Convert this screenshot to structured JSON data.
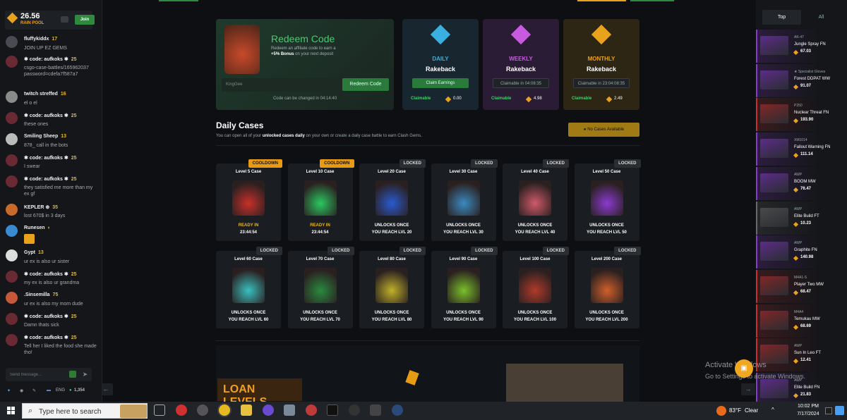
{
  "chat": {
    "rain_amount": "26.56",
    "rain_label": "RAIN POOL",
    "join_label": "Join",
    "messages": [
      {
        "name": "fluffykiddx",
        "level": "17",
        "text": "JOIN UP EZ GEMS",
        "avatar_color": "#4a4a52"
      },
      {
        "name": "✱ code: aufkoks ✱",
        "level": "25",
        "text": "csgo-case-battles/165962037 password=cdefa7f587a7",
        "avatar_color": "#6a2a34"
      },
      {
        "name": "twitch streffed",
        "level": "16",
        "text": "el o el",
        "avatar_color": "#8a8a8a"
      },
      {
        "name": "✱ code: aufkoks ✱",
        "level": "25",
        "text": "these ones",
        "avatar_color": "#6a2a34"
      },
      {
        "name": "Smiling Sheep",
        "level": "13",
        "text": "878_ call in the bots",
        "avatar_color": "#bbbbbb"
      },
      {
        "name": "✱ code: aufkoks ✱",
        "level": "25",
        "text": "I swear",
        "avatar_color": "#6a2a34"
      },
      {
        "name": "✱ code: aufkoks ✱",
        "level": "25",
        "text": "they satisfied me more than my ex gf",
        "avatar_color": "#6a2a34"
      },
      {
        "name": "KEPLER ⊕",
        "level": "35",
        "text": "lost 670$ in 3 days",
        "avatar_color": "#c86a2a"
      },
      {
        "name": "Runesen",
        "level": "◐",
        "text": "",
        "avatar_color": "#3a8ad0"
      },
      {
        "name": "Gypt",
        "level": "13",
        "text": "ur ex is also ur sister",
        "avatar_color": "#dddddd"
      },
      {
        "name": "✱ code: aufkoks ✱",
        "level": "25",
        "text": "my ex is also ur grandma",
        "avatar_color": "#6a2a34"
      },
      {
        "name": ".Sinsemilla",
        "level": "75",
        "text": "ur ex is also my mom dude",
        "avatar_color": "#c8583a"
      },
      {
        "name": "✱ code: aufkoks ✱",
        "level": "25",
        "text": "Damn thats sick",
        "avatar_color": "#6a2a34"
      },
      {
        "name": "✱ code: aufkoks ✱",
        "level": "25",
        "text": "Tell her I liked the food she made tho!",
        "avatar_color": "#6a2a34"
      }
    ],
    "input_placeholder": "Send message...",
    "send_icon": "send-arrow-icon",
    "footer": {
      "lang": "ENG",
      "online": "1,354"
    }
  },
  "redeem": {
    "title": "Redeem Code",
    "desc_line1": "Redeem an affiliate code to earn a",
    "bonus": "+5% Bonus",
    "desc_line2_rest": " on your next deposit",
    "input_value": "KingGee",
    "button": "Redeem Code",
    "note": "Code can be changed in 04:14:40"
  },
  "rakeback": [
    {
      "period": "DAILY",
      "label": "Rakeback",
      "button": "Claim Earnings",
      "claimable_label": "Claimable",
      "value": "0.00",
      "color": "#3ab0e0",
      "bg": "#182630",
      "active": true
    },
    {
      "period": "WEEKLY",
      "label": "Rakeback",
      "button": "Claimable in 04:08:35",
      "claimable_label": "Claimable",
      "value": "4.98",
      "color": "#c85ae0",
      "bg": "#2a1c34",
      "active": false
    },
    {
      "period": "MONTHLY",
      "label": "Rakeback",
      "button": "Claimable in 23:04:08:35",
      "claimable_label": "Claimable",
      "value": "2.49",
      "color": "#e8a21c",
      "bg": "#2e2614",
      "active": false
    }
  ],
  "daily": {
    "title": "Daily Cases",
    "sub_pre": "You can open all of your ",
    "sub_bold": "unlocked cases daily",
    "sub_post": " on your own or create a daily case battle to earn Clash Gems.",
    "no_cases": "No Cases Available"
  },
  "cases": [
    {
      "name": "Level 5 Case",
      "tag": "COOLDOWN",
      "status1": "READY IN",
      "status2": "23:44:54",
      "color": "#c8302a"
    },
    {
      "name": "Level 10 Case",
      "tag": "COOLDOWN",
      "status1": "READY IN",
      "status2": "23:44:54",
      "color": "#2ac860"
    },
    {
      "name": "Level 20 Case",
      "tag": "LOCKED",
      "status1": "UNLOCKS ONCE",
      "status2": "YOU REACH LVL 20",
      "color": "#2a5ad0"
    },
    {
      "name": "Level 30 Case",
      "tag": "LOCKED",
      "status1": "UNLOCKS ONCE",
      "status2": "YOU REACH LVL 30",
      "color": "#3a8ac0"
    },
    {
      "name": "Level 40 Case",
      "tag": "LOCKED",
      "status1": "UNLOCKS ONCE",
      "status2": "YOU REACH LVL 40",
      "color": "#d05a6a"
    },
    {
      "name": "Level 50 Case",
      "tag": "LOCKED",
      "status1": "UNLOCKS ONCE",
      "status2": "YOU REACH LVL 50",
      "color": "#8a3ad0"
    },
    {
      "name": "Level 60 Case",
      "tag": "LOCKED",
      "status1": "UNLOCKS ONCE",
      "status2": "YOU REACH LVL 60",
      "color": "#3ac0c0"
    },
    {
      "name": "Level 70 Case",
      "tag": "LOCKED",
      "status1": "UNLOCKS ONCE",
      "status2": "YOU REACH LVL 70",
      "color": "#2a8a40"
    },
    {
      "name": "Level 80 Case",
      "tag": "LOCKED",
      "status1": "UNLOCKS ONCE",
      "status2": "YOU REACH LVL 80",
      "color": "#c0b02a"
    },
    {
      "name": "Level 90 Case",
      "tag": "LOCKED",
      "status1": "UNLOCKS ONCE",
      "status2": "YOU REACH LVL 90",
      "color": "#7ac02a"
    },
    {
      "name": "Level 100 Case",
      "tag": "LOCKED",
      "status1": "UNLOCKS ONCE",
      "status2": "YOU REACH LVL 100",
      "color": "#b03a2a"
    },
    {
      "name": "Level 200 Case",
      "tag": "LOCKED",
      "status1": "UNLOCKS ONCE",
      "status2": "YOU REACH LVL 200",
      "color": "#d0602a"
    }
  ],
  "loan": {
    "title": "LOAN LEVELS"
  },
  "drops": {
    "tabs": [
      "Top",
      "All"
    ],
    "items": [
      {
        "type": "AK-47",
        "name": "Jungle Spray FN",
        "price": "67.03",
        "color": "#8a3ad0"
      },
      {
        "type": "★ Specialist Gloves",
        "name": "Forest DDPAT WW",
        "price": "91.07",
        "color": "#8a3ad0"
      },
      {
        "type": "P250",
        "name": "Nuclear Threat FN",
        "price": "193.90",
        "color": "#c83030"
      },
      {
        "type": "XM1014",
        "name": "Fallout Warning FN",
        "price": "111.14",
        "color": "#8a3ad0"
      },
      {
        "type": "AWP",
        "name": "BOOM MW",
        "price": "76.47",
        "color": "#8a3ad0"
      },
      {
        "type": "AWP",
        "name": "Elite Build FT",
        "price": "10.23",
        "color": "#6a6a6a"
      },
      {
        "type": "AWP",
        "name": "Graphite FN",
        "price": "140.98",
        "color": "#8a3ad0"
      },
      {
        "type": "M4A1-S",
        "name": "Player Two MW",
        "price": "68.47",
        "color": "#c83030"
      },
      {
        "type": "M4A4",
        "name": "Temukau MW",
        "price": "68.69",
        "color": "#c83030"
      },
      {
        "type": "AWP",
        "name": "Sun In Leo FT",
        "price": "12.41",
        "color": "#c83030"
      },
      {
        "type": "AWP",
        "name": "Elite Build FN",
        "price": "21.83",
        "color": "#8a3ad0"
      }
    ]
  },
  "watermark": {
    "line1": "Activate Windows",
    "line2": "Go to Settings to activate Windows."
  },
  "taskbar": {
    "search_placeholder": "Type here to search",
    "temp": "83°F",
    "weather": "Clear",
    "time": "10:02 PM",
    "date": "7/17/2024"
  }
}
